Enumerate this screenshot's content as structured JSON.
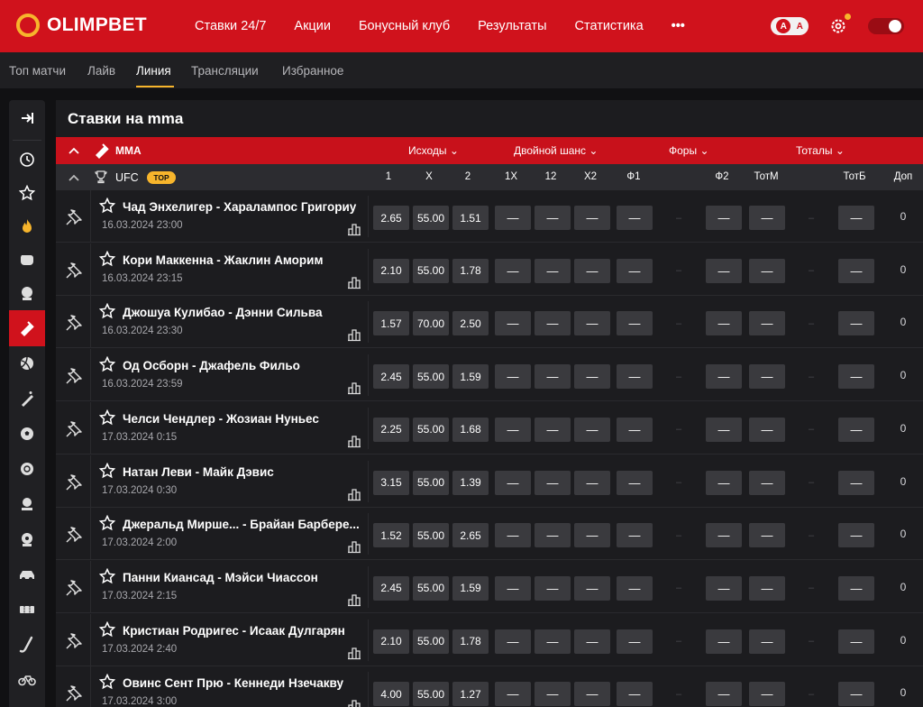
{
  "header": {
    "brand": "OLIMPBET",
    "nav": [
      "Ставки 24/7",
      "Акции",
      "Бонусный клуб",
      "Результаты",
      "Статистика",
      "•••"
    ],
    "lang_a1": "A",
    "lang_a2": "A",
    "accent": "#d0121c",
    "gold": "#f7b52c"
  },
  "subnav": {
    "items": [
      "Топ матчи",
      "Лайв",
      "Линия",
      "Трансляции",
      "Избранное"
    ],
    "active": "Линия"
  },
  "sidebar": {
    "icons": [
      "collapse-icon",
      "clock-icon",
      "star-icon",
      "fire-icon",
      "glove-icon",
      "helmet-icon",
      "mma-icon",
      "volleyball-icon",
      "cricket-icon",
      "football-icon",
      "basketball-icon",
      "esports-icon",
      "handball-icon",
      "car-icon",
      "ticket-icon",
      "hockey-icon",
      "bike-icon"
    ]
  },
  "main": {
    "title": "Ставки на mma",
    "sport": "ММА",
    "groups": [
      "Исходы",
      "Двойной шанс",
      "Форы",
      "Тоталы"
    ],
    "league": "UFC",
    "league_badge": "TOP",
    "columns": [
      "1",
      "X",
      "2",
      "1X",
      "12",
      "X2",
      "Ф1",
      "Ф2",
      "ТотМ",
      "ТотБ",
      "Доп"
    ],
    "dash": "—",
    "empty": "–"
  },
  "matches": [
    {
      "name": "Чад Энхелигер - Харалампос Григориу",
      "date": "16.03.2024 23:00",
      "o1": "2.65",
      "ox": "55.00",
      "o2": "1.51",
      "dop": "0"
    },
    {
      "name": "Кори Маккенна - Жаклин Аморим",
      "date": "16.03.2024 23:15",
      "o1": "2.10",
      "ox": "55.00",
      "o2": "1.78",
      "dop": "0"
    },
    {
      "name": "Джошуа Кулибао - Дэнни Сильва",
      "date": "16.03.2024 23:30",
      "o1": "1.57",
      "ox": "70.00",
      "o2": "2.50",
      "dop": "0"
    },
    {
      "name": "Од Осборн - Джафель Фильо",
      "date": "16.03.2024 23:59",
      "o1": "2.45",
      "ox": "55.00",
      "o2": "1.59",
      "dop": "0"
    },
    {
      "name": "Челси Чендлер - Жозиан Нуньес",
      "date": "17.03.2024 0:15",
      "o1": "2.25",
      "ox": "55.00",
      "o2": "1.68",
      "dop": "0"
    },
    {
      "name": "Натан Леви - Майк Дэвис",
      "date": "17.03.2024 0:30",
      "o1": "3.15",
      "ox": "55.00",
      "o2": "1.39",
      "dop": "0"
    },
    {
      "name": "Джеральд Мирше... - Брайан Барбере...",
      "date": "17.03.2024 2:00",
      "o1": "1.52",
      "ox": "55.00",
      "o2": "2.65",
      "dop": "0"
    },
    {
      "name": "Панни Киансад - Мэйси Чиассон",
      "date": "17.03.2024 2:15",
      "o1": "2.45",
      "ox": "55.00",
      "o2": "1.59",
      "dop": "0"
    },
    {
      "name": "Кристиан Родригес - Исаак Дулгарян",
      "date": "17.03.2024 2:40",
      "o1": "2.10",
      "ox": "55.00",
      "o2": "1.78",
      "dop": "0"
    },
    {
      "name": "Овинс Сент Прю - Кеннеди Нзечакву",
      "date": "17.03.2024 3:00",
      "o1": "4.00",
      "ox": "55.00",
      "o2": "1.27",
      "dop": "0"
    }
  ]
}
